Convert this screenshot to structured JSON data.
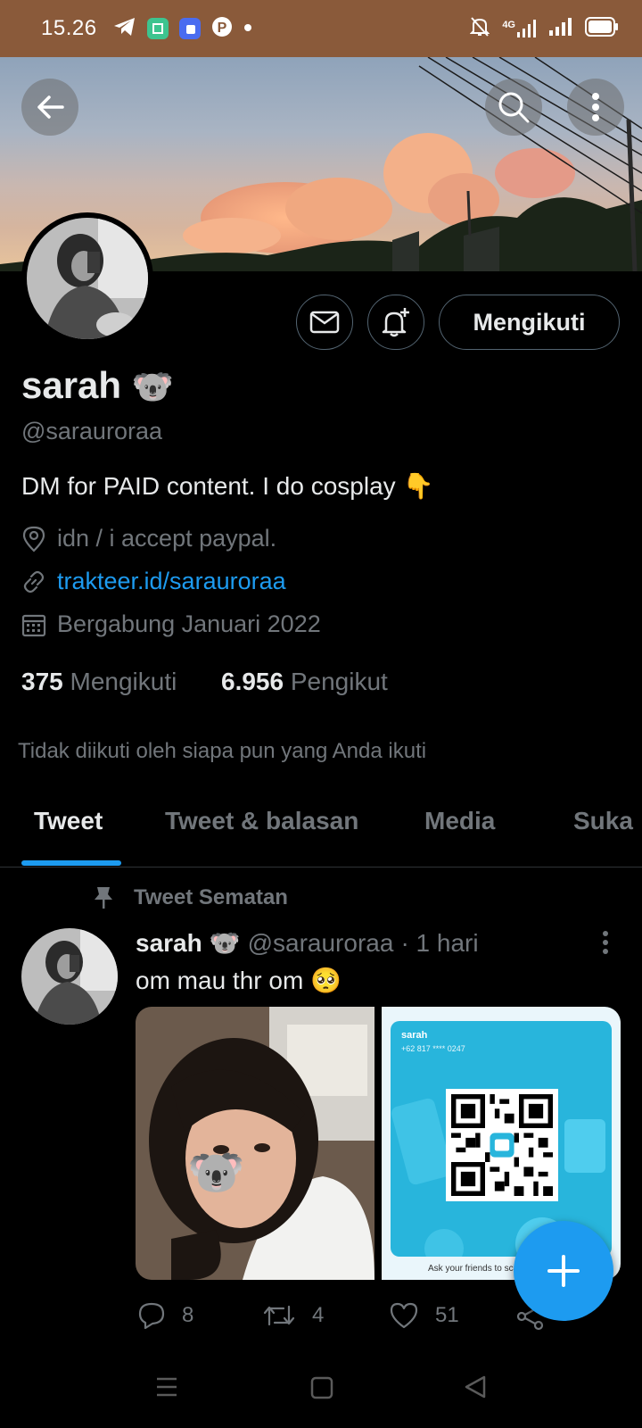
{
  "status_bar": {
    "time": "15.26",
    "network": "4G"
  },
  "profile": {
    "name": "sarah",
    "name_emoji": "🐨",
    "handle": "@sarauroraa",
    "bio": "DM for PAID content. I do cosplay 👇",
    "location": "idn / i accept paypal.",
    "link": "trakteer.id/sarauroraa",
    "joined": "Bergabung Januari 2022",
    "following_count": "375",
    "following_label": "Mengikuti",
    "followers_count": "6.956",
    "followers_label": "Pengikut",
    "mutuals_note": "Tidak diikuti oleh siapa pun yang Anda ikuti",
    "follow_button": "Mengikuti"
  },
  "tabs": [
    "Tweet",
    "Tweet & balasan",
    "Media",
    "Suka"
  ],
  "pinned_tweet": {
    "pinned_label": "Tweet Sematan",
    "author_name": "sarah",
    "author_emoji": "🐨",
    "author_handle": "@sarauroraa",
    "time": "· 1 hari",
    "text": "om mau thr om 🥺",
    "qr_card": {
      "name": "sarah",
      "phone": "+62 817 **** 0247",
      "caption": "Ask your friends to sca"
    },
    "sticker_emoji": "🐨",
    "replies": "8",
    "retweets": "4",
    "likes": "51"
  },
  "colors": {
    "accent": "#1d9bf0",
    "status_bar": "#8a5a3a",
    "muted": "#71767b"
  }
}
